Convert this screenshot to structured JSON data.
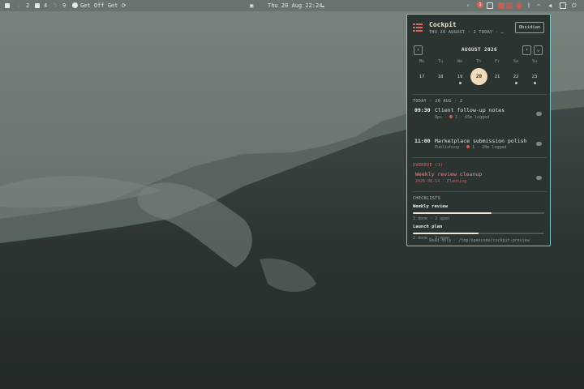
{
  "topbar": {
    "workspaces": [
      "1",
      "2",
      "3",
      "4",
      "5",
      "9"
    ],
    "active_app": "Get Off Get",
    "active_app_icon": "circle-icon",
    "clock": "Thu 20 Aug 22:24",
    "notification_badge": "1"
  },
  "panel": {
    "title": "Cockpit",
    "subtitle": "THU 20 AUGUST · 2 TODAY · …",
    "open_button": "Obsidian",
    "calendar": {
      "month_label": "AUGUST 2026",
      "prev": "‹",
      "next": "›",
      "expand": "⌄",
      "weekdays": [
        "Mo",
        "Tu",
        "We",
        "Th",
        "Fr",
        "Sa",
        "Su"
      ],
      "days": [
        "17",
        "18",
        "19",
        "20",
        "21",
        "22",
        "23"
      ],
      "today": "20"
    },
    "today_header": "TODAY · 20 AUG · 2",
    "events": [
      {
        "time": "09:30",
        "title": "Client follow-up notes",
        "meta_a": "Ops ·",
        "meta_b": "1 · 65m logged"
      },
      {
        "time": "11:00",
        "title": "Marketplace submission polish",
        "meta_a": "Publishing ·",
        "meta_b": "1 · 20m logged"
      }
    ],
    "overdue_header": "OVERDUE (1)",
    "overdue": [
      {
        "title": "Weekly review cleanup",
        "meta": "2026-08-14 · Planning"
      }
    ],
    "checklists_header": "CHECKLISTS",
    "checklists": [
      {
        "name": "Weekly review",
        "meta": "3 done · 2 open",
        "progress": 0.6
      },
      {
        "name": "Launch plan",
        "meta": "2 done · 2 open",
        "progress": 0.5
      }
    ],
    "footer": "Read-only · /tmp/opencode/cockpit-preview"
  },
  "colors": {
    "panel_bg": "#2c3432",
    "panel_border": "#7fc2bd",
    "today_circle": "#f0dcbd",
    "overdue": "#e06b62",
    "accent_red": "#d35a54"
  }
}
